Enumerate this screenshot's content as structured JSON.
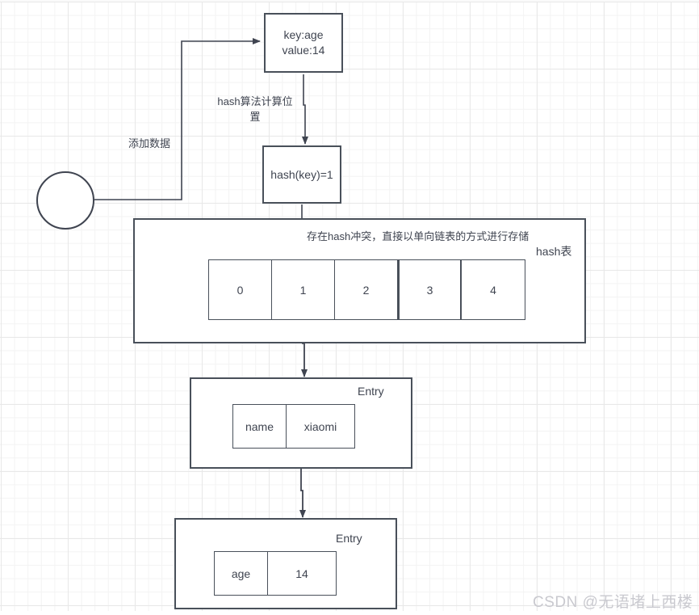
{
  "diagram": {
    "title_nodes": {
      "input_node_label": "",
      "key_value_box": "key:age\nvalue:14",
      "hash_fn_box": "hash(key)=1"
    },
    "edge_labels": {
      "add_data": "添加数据",
      "hash_calc_position": "hash算法计算位\n置",
      "hash_collision": "存在hash冲突，直接以单向链表的方式进行存储"
    },
    "hash_table": {
      "corner_label": "hash表",
      "cells": [
        "0",
        "1",
        "2",
        "3",
        "4"
      ]
    },
    "entries": [
      {
        "corner_label": "Entry",
        "key": "name",
        "value": "xiaomi"
      },
      {
        "corner_label": "Entry",
        "key": "age",
        "value": "14"
      }
    ],
    "watermark": "CSDN @无语堵上西楼",
    "colors": {
      "stroke": "#49505a",
      "text": "#3f4450",
      "grid_minor": "#f3f3f3",
      "grid_major": "#e8e8e8",
      "watermark": "#c9c9cf"
    }
  }
}
